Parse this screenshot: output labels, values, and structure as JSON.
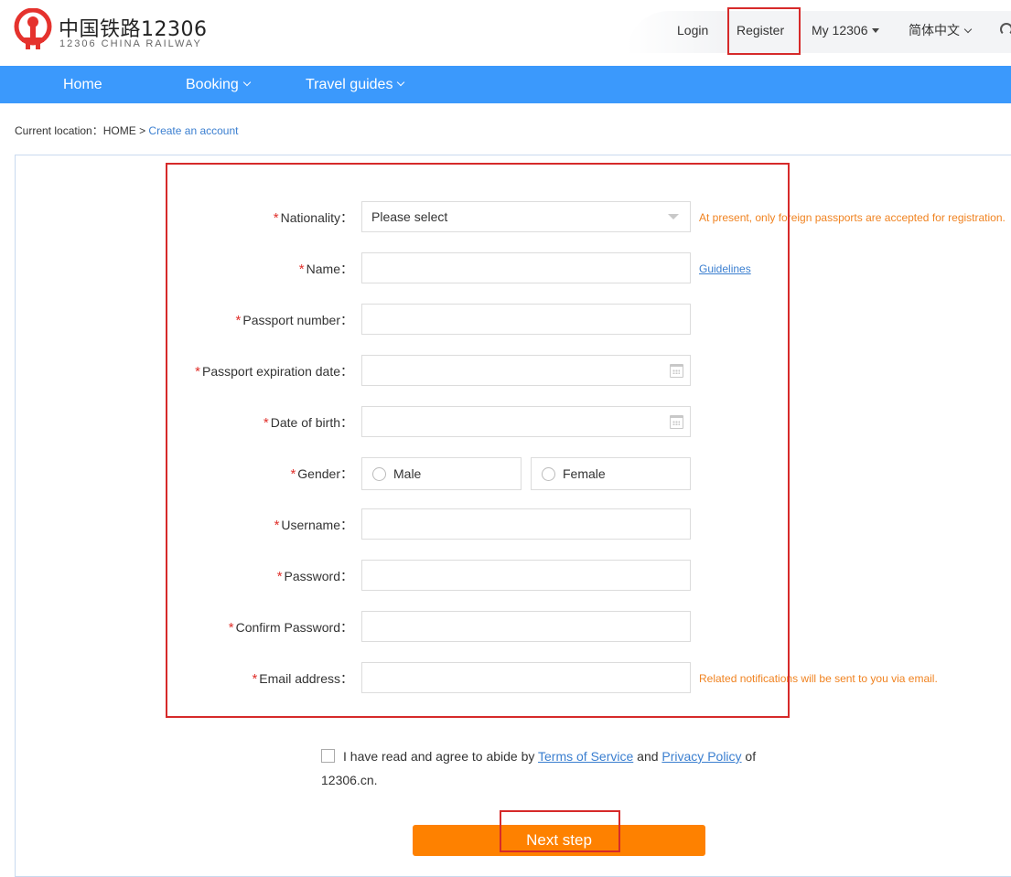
{
  "header": {
    "logo_cn": "中国铁路12306",
    "logo_en": "12306 CHINA RAILWAY",
    "login": "Login",
    "register": "Register",
    "my": "My 12306",
    "lang": "简体中文"
  },
  "nav": {
    "home": "Home",
    "booking": "Booking",
    "guides": "Travel guides"
  },
  "breadcrumb": {
    "prefix": "Current location：",
    "home": "HOME",
    "sep": ">",
    "current": "Create an account"
  },
  "form": {
    "required_mark": "*",
    "nationality": {
      "label": "Nationality：",
      "value": "Please select",
      "hint": "At present, only foreign passports are accepted for registration."
    },
    "name": {
      "label": "Name：",
      "link": "Guidelines"
    },
    "passport_number": {
      "label": "Passport number："
    },
    "passport_expiration": {
      "label": "Passport expiration date："
    },
    "dob": {
      "label": "Date of birth："
    },
    "gender": {
      "label": "Gender：",
      "male": "Male",
      "female": "Female"
    },
    "username": {
      "label": "Username："
    },
    "password": {
      "label": "Password："
    },
    "confirm_password": {
      "label": "Confirm Password："
    },
    "email": {
      "label": "Email address：",
      "hint": "Related notifications will be sent to you via email."
    }
  },
  "agreement": {
    "text1": "I have read and agree to abide by ",
    "terms": "Terms of Service",
    "and": " and ",
    "privacy": "Privacy Policy",
    "text2": " of 12306.cn."
  },
  "next_button": "Next step",
  "colors": {
    "nav_blue": "#3b99fc",
    "accent_orange": "#fe8100",
    "hint_orange": "#f08321",
    "link_blue": "#3b7fd0",
    "annotation_red": "#d62a2a"
  }
}
